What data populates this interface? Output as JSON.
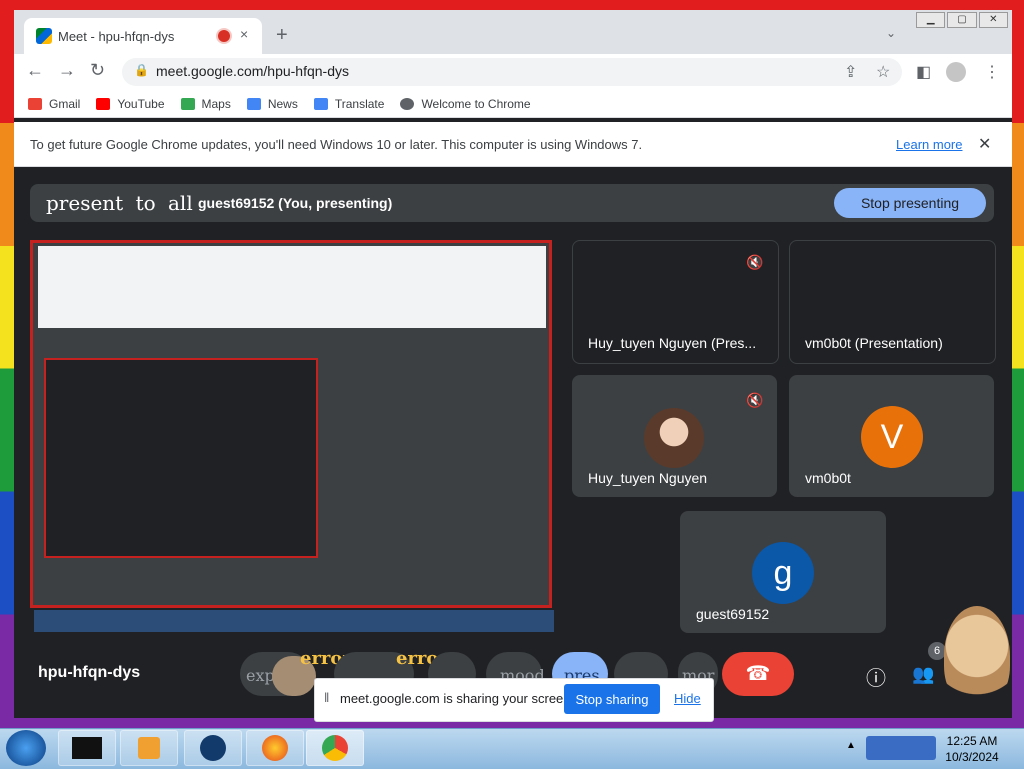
{
  "browser": {
    "tab_title": "Meet - hpu-hfqn-dys",
    "tab_close": "×",
    "new_tab": "+",
    "url": "meet.google.com/hpu-hfqn-dys",
    "window_controls": [
      "▁",
      "▢",
      "✕"
    ],
    "bookmarks": [
      {
        "label": "Gmail",
        "icon": "gmail-icon",
        "color": "#ea4335"
      },
      {
        "label": "YouTube",
        "icon": "youtube-icon",
        "color": "#ff0000"
      },
      {
        "label": "Maps",
        "icon": "maps-icon",
        "color": "#34a853"
      },
      {
        "label": "News",
        "icon": "news-icon",
        "color": "#4285f4"
      },
      {
        "label": "Translate",
        "icon": "translate-icon",
        "color": "#4285f4"
      },
      {
        "label": "Welcome to Chrome",
        "icon": "chrome-icon",
        "color": "#5f6368"
      }
    ],
    "infobar": {
      "text": "To get future Google Chrome updates, you'll need Windows 10 or later. This computer is using Windows 7.",
      "link": "Learn more",
      "close": "✕"
    }
  },
  "meet": {
    "present_title": "present to all",
    "presenter": "guest69152 (You, presenting)",
    "stop_presenting": "Stop presenting",
    "tiles": {
      "t1": "Huy_tuyen Nguyen (Pres...",
      "t2": "vm0b0t (Presentation)",
      "t3": "Huy_tuyen Nguyen",
      "t4": "vm0b0t",
      "t5": "guest69152"
    },
    "avatar_v": "V",
    "avatar_g": "g",
    "meeting_code": "hpu-hfqn-dys",
    "controls": {
      "expand": "expand",
      "err1": "error",
      "err2": "error",
      "mood": "mood",
      "pres": "pres",
      "more": "mor",
      "hangup": "☎",
      "participants_count": "6",
      "info": "ⓘ"
    },
    "sharebar": {
      "text": "meet.google.com is sharing your screen.",
      "stop": "Stop sharing",
      "hide": "Hide"
    }
  },
  "taskbar": {
    "time": "12:25 AM",
    "date": "10/3/2024",
    "tray_up": "▲"
  }
}
